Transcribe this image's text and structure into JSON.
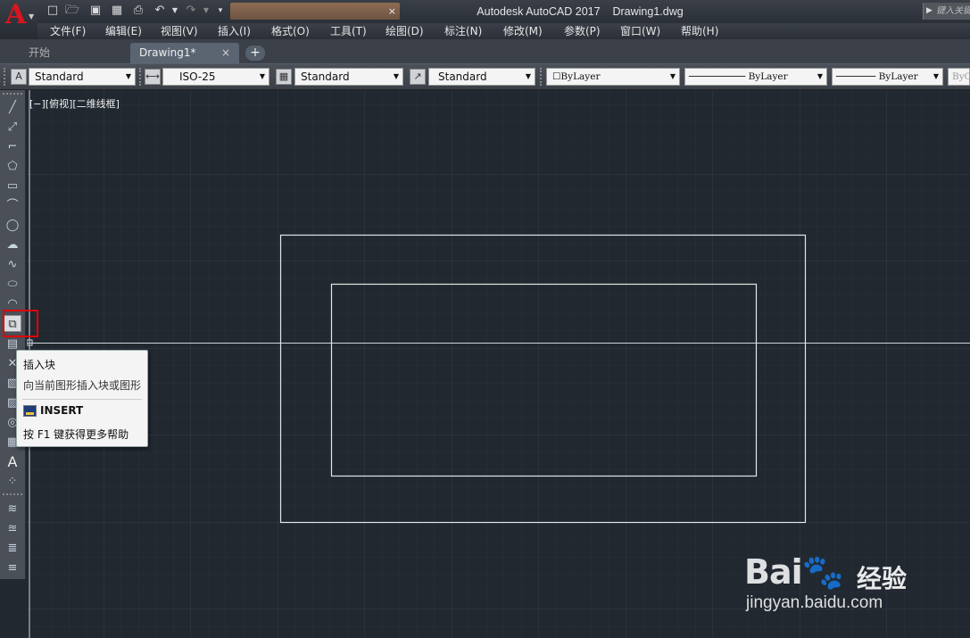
{
  "app": {
    "title": "Autodesk AutoCAD 2017",
    "document": "Drawing1.dwg",
    "logo_letter": "A",
    "help_search_placeholder": "键入关键字或短语"
  },
  "quick_access": {
    "icons": [
      "new-icon",
      "open-icon",
      "save-icon",
      "save-as-icon",
      "plot-icon",
      "undo-icon",
      "undo-dropdown-icon",
      "redo-icon",
      "redo-dropdown-icon",
      "customize-icon"
    ],
    "search_close": "×"
  },
  "menu": [
    "文件(F)",
    "编辑(E)",
    "视图(V)",
    "插入(I)",
    "格式(O)",
    "工具(T)",
    "绘图(D)",
    "标注(N)",
    "修改(M)",
    "参数(P)",
    "窗口(W)",
    "帮助(H)"
  ],
  "tabs": {
    "start": "开始",
    "drawing": "Drawing1*",
    "close": "×",
    "add": "+"
  },
  "styles_toolbar": {
    "text_style": "Standard",
    "dim_style": "ISO-25",
    "table_style": "Standard",
    "multileader_style": "Standard",
    "color": "ByLayer",
    "linetype": "ByLayer",
    "lineweight": "ByLayer",
    "plot_style": "ByColor"
  },
  "draw_tools": [
    "line-icon",
    "construction-line-icon",
    "polyline-icon",
    "polygon-icon",
    "rectangle-icon",
    "arc-icon",
    "circle-icon",
    "revision-cloud-icon",
    "spline-icon",
    "ellipse-icon",
    "ellipse-arc-icon",
    "insert-block-icon",
    "make-block-icon",
    "point-icon",
    "hatch-icon",
    "gradient-icon",
    "region-icon",
    "table-icon",
    "multiline-text-icon",
    "add-selected-icon"
  ],
  "layer_tools": [
    "layer-properties-icon",
    "layer-state-icon",
    "layer-previous-icon",
    "layer-isolate-icon"
  ],
  "viewport_label": "[−][俯视][二维线框]",
  "tooltip": {
    "title": "插入块",
    "description": "向当前图形插入块或图形",
    "command": "INSERT",
    "help": "按 F1 键获得更多帮助"
  },
  "watermark": {
    "logo": "Bai",
    "logo_suffix": "du",
    "paw": "🐾",
    "jingyan": "经验",
    "url": "jingyan.baidu.com"
  },
  "colors": {
    "canvas": "#212830",
    "grid": "#2c3440",
    "highlight": "#e00000",
    "geometry": "#e6e6e6"
  }
}
